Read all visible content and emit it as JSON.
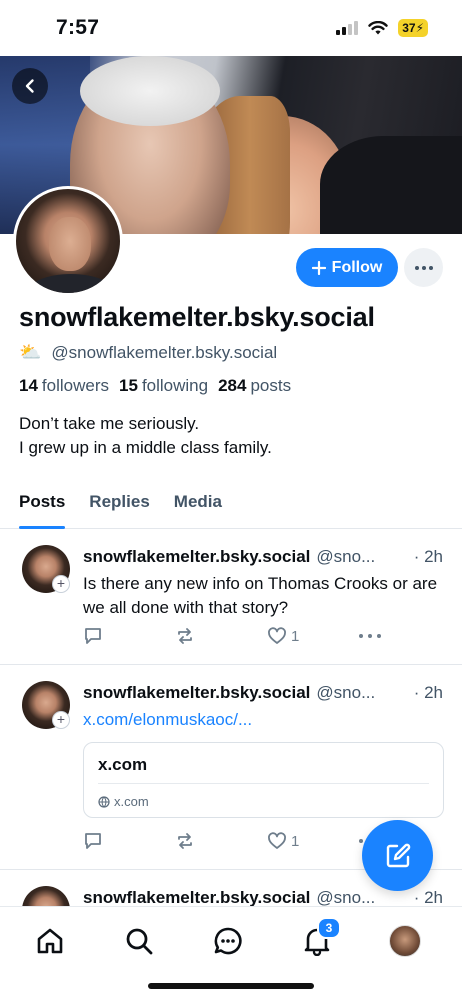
{
  "status_bar": {
    "time": "7:57",
    "battery": "37"
  },
  "profile": {
    "display_name": "snowflakemelter.bsky.social",
    "handle_emoji": "⛅",
    "handle": "@snowflakemelter.bsky.social",
    "followers_count": "14",
    "followers_label": "followers",
    "following_count": "15",
    "following_label": "following",
    "posts_count": "284",
    "posts_label": "posts",
    "bio_line1": "Don’t take me seriously.",
    "bio_line2": "I grew up in a middle class family."
  },
  "actions": {
    "follow_label": "Follow"
  },
  "tabs": [
    {
      "label": "Posts",
      "active": true
    },
    {
      "label": "Replies",
      "active": false
    },
    {
      "label": "Media",
      "active": false
    }
  ],
  "posts": [
    {
      "author": "snowflakemelter.bsky.social",
      "handle": "@sno...",
      "time": "· 2h",
      "text": "Is there any new info on Thomas Crooks or are we all done with that story?",
      "likes": "1"
    },
    {
      "author": "snowflakemelter.bsky.social",
      "handle": "@sno...",
      "time": "· 2h",
      "link_text": "x.com/elonmuskaoc/...",
      "card_title": "x.com",
      "card_domain": "x.com",
      "likes": "1"
    },
    {
      "author": "snowflakemelter.bsky.social",
      "handle": "@sno...",
      "time": "· 2h"
    }
  ],
  "nav": {
    "notifications_badge": "3"
  },
  "colors": {
    "accent": "#1a83ff",
    "muted": "#425466"
  }
}
